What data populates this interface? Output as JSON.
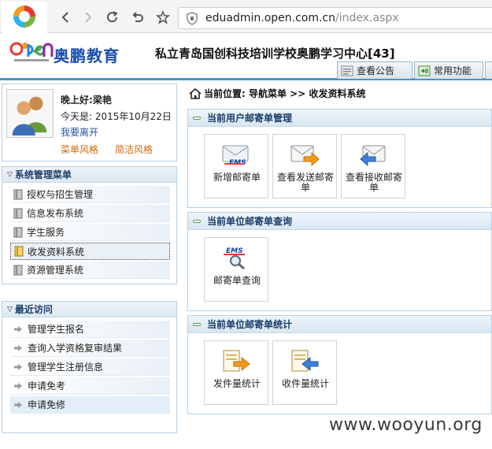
{
  "browser": {
    "url_host": "eduadmin.open.com.cn",
    "url_path": "/index.aspx"
  },
  "header": {
    "logo_text": "奥鹏教育",
    "school_title": "私立青岛国创科技培训学校奥鹏学习中心[43]",
    "tabs": [
      {
        "label": "查看公告"
      },
      {
        "label": "常用功能"
      }
    ]
  },
  "user": {
    "greeting_prefix": "晚上好:",
    "name": "梁艳",
    "today_label": "今天是: 2015年10月22日",
    "logout": "我要离开",
    "style_menu": "菜单风格",
    "style_simple": "简洁风格"
  },
  "system_menu": {
    "title": "系统管理菜单",
    "items": [
      {
        "label": "授权与招生管理"
      },
      {
        "label": "信息发布系统"
      },
      {
        "label": "学生服务"
      },
      {
        "label": "收发资料系统"
      },
      {
        "label": "资源管理系统"
      }
    ]
  },
  "recent": {
    "title": "最近访问",
    "items": [
      {
        "label": "管理学生报名"
      },
      {
        "label": "查询入学资格复审结果"
      },
      {
        "label": "管理学生注册信息"
      },
      {
        "label": "申请免考"
      },
      {
        "label": "申请免修"
      }
    ]
  },
  "main": {
    "breadcrumb": "当前位置: 导航菜单 >> 收发资料系统",
    "sections": [
      {
        "title": "当前用户邮寄单管理",
        "tiles": [
          {
            "label": "新增邮寄单",
            "icon": "ems-new-icon"
          },
          {
            "label": "查看发送邮寄单",
            "icon": "send-mail-icon"
          },
          {
            "label": "查看接收邮寄单",
            "icon": "receive-mail-icon"
          }
        ]
      },
      {
        "title": "当前单位邮寄单查询",
        "tiles": [
          {
            "label": "邮寄单查询",
            "icon": "ems-search-icon"
          }
        ]
      },
      {
        "title": "当前单位邮寄单统计",
        "tiles": [
          {
            "label": "发件量统计",
            "icon": "send-stat-icon"
          },
          {
            "label": "收件量统计",
            "icon": "receive-stat-icon"
          }
        ]
      }
    ]
  },
  "watermark": "www.wooyun.org",
  "colors": {
    "accent_blue": "#4d93c8",
    "link_orange": "#d2670a",
    "link_blue": "#2456a8"
  }
}
